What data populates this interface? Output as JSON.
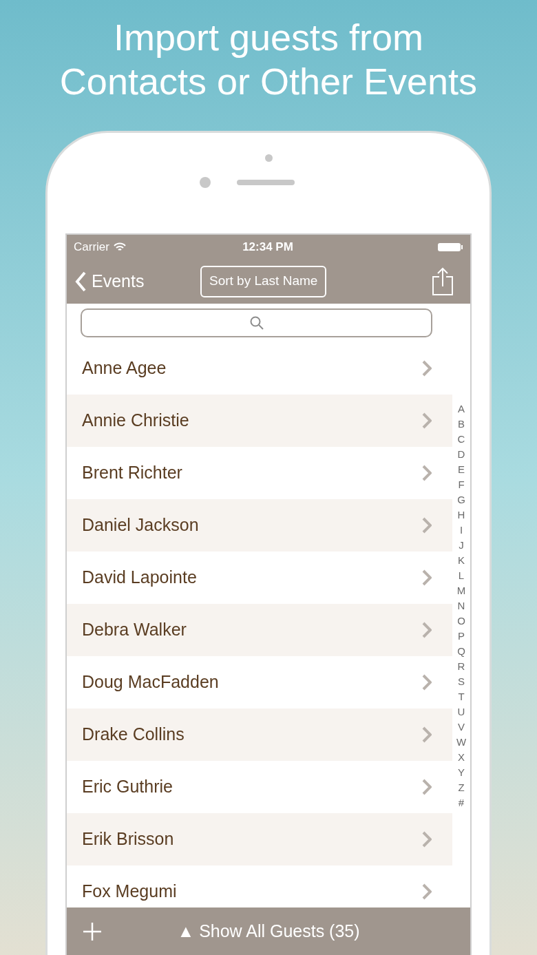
{
  "headline": [
    "Import guests from",
    "Contacts or Other Events"
  ],
  "status_bar": {
    "carrier": "Carrier",
    "time": "12:34 PM"
  },
  "nav_bar": {
    "back_label": "Events",
    "sort_button": "Sort by Last Name"
  },
  "guests": [
    "Anne Agee",
    "Annie Christie",
    "Brent Richter",
    "Daniel Jackson",
    "David Lapointe",
    "Debra Walker",
    "Doug MacFadden",
    "Drake Collins",
    "Eric Guthrie",
    "Erik Brisson",
    "Fox Megumi"
  ],
  "index": [
    "A",
    "B",
    "C",
    "D",
    "E",
    "F",
    "G",
    "H",
    "I",
    "J",
    "K",
    "L",
    "M",
    "N",
    "O",
    "P",
    "Q",
    "R",
    "S",
    "T",
    "U",
    "V",
    "W",
    "X",
    "Y",
    "Z",
    "#"
  ],
  "toolbar": {
    "show_all": "▲ Show All Guests (35)"
  }
}
